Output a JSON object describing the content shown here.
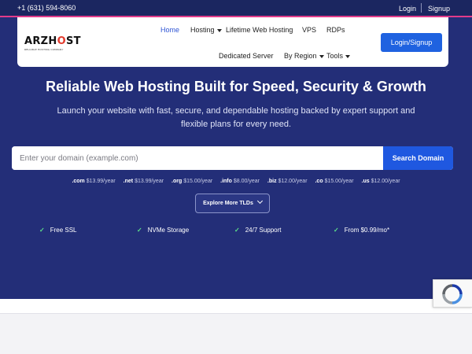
{
  "topbar": {
    "phone": "+1 (631) 594-8060",
    "login": "Login",
    "signup": "Signup",
    "accent_color": "#e23b8a"
  },
  "logo": {
    "brand_prefix": "ARZH",
    "brand_o": "O",
    "brand_suffix": "ST",
    "tagline": "RELIABLE HOSTING COMPANY"
  },
  "nav": {
    "home": "Home",
    "hosting": "Hosting",
    "lifetime": "Lifetime Web Hosting",
    "vps": "VPS",
    "rdps": "RDPs",
    "dedicated": "Dedicated Server",
    "by_region": "By Region",
    "tools": "Tools",
    "login_signup": "Login/Signup"
  },
  "hero": {
    "headline": "Reliable Web Hosting Built for Speed, Security & Growth",
    "subtext": "Launch your website with fast, secure, and dependable hosting backed by expert support and flexible plans for every need.",
    "background_color": "#232e78"
  },
  "search": {
    "placeholder": "Enter your domain (example.com)",
    "value": "",
    "button": "Search Domain"
  },
  "tlds": [
    {
      "ext": ".com",
      "price": "$13.99/year"
    },
    {
      "ext": ".net",
      "price": "$13.99/year"
    },
    {
      "ext": ".org",
      "price": "$15.00/year"
    },
    {
      "ext": ".info",
      "price": "$8.00/year"
    },
    {
      "ext": ".biz",
      "price": "$12.00/year"
    },
    {
      "ext": ".co",
      "price": "$15.00/year"
    },
    {
      "ext": ".us",
      "price": "$12.00/year"
    }
  ],
  "explore_button": "Explore More TLDs",
  "features": [
    {
      "check": "✓",
      "label": "Free SSL"
    },
    {
      "check": "✓",
      "label": "NVMe Storage"
    },
    {
      "check": "✓",
      "label": "24/7 Support"
    },
    {
      "check": "✓",
      "label": "From $0.99/mo*"
    }
  ],
  "icons": {
    "recaptcha": "recaptcha-icon",
    "check": "check-icon",
    "caret": "caret-down-icon",
    "chevron": "chevron-down-icon"
  }
}
